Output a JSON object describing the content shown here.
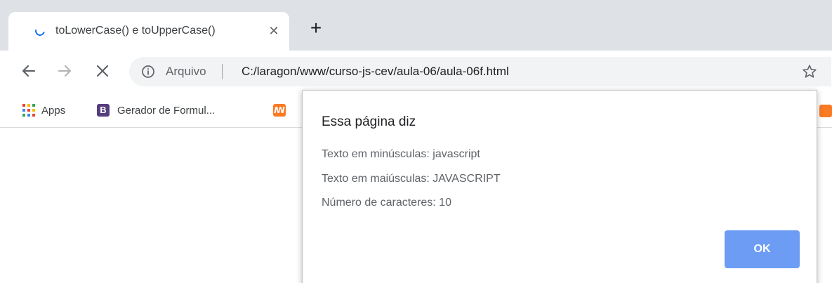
{
  "tab": {
    "title": "toLowerCase() e toUpperCase()",
    "close_glyph": "✕",
    "new_tab_glyph": "+"
  },
  "toolbar": {
    "back_icon": "arrow-left-icon",
    "forward_icon": "arrow-right-icon",
    "stop_icon": "close-icon",
    "origin_label": "Arquivo",
    "url": "C:/laragon/www/curso-js-cev/aula-06/aula-06f.html"
  },
  "bookmarks": {
    "items": [
      {
        "label": "Apps",
        "icon": "apps-grid-icon"
      },
      {
        "label": "Gerador de Formul...",
        "icon": "bootstrap-icon",
        "icon_glyph": "B"
      },
      {
        "label": "",
        "icon": "xampp-icon",
        "icon_glyph": "ꟿ"
      }
    ]
  },
  "dialog": {
    "title": "Essa página diz",
    "lines": [
      "Texto em minúsculas: javascript",
      "Texto em maiúsculas: JAVASCRIPT",
      "Número de caracteres: 10"
    ],
    "ok_label": "OK"
  },
  "colors": {
    "tabstrip": "#dee1e6",
    "omnibox": "#f1f3f4",
    "ok_button": "#6c9cf4",
    "spinner": "#1a73e8",
    "bootstrap": "#563d7c",
    "xampp": "#fb7a24"
  }
}
